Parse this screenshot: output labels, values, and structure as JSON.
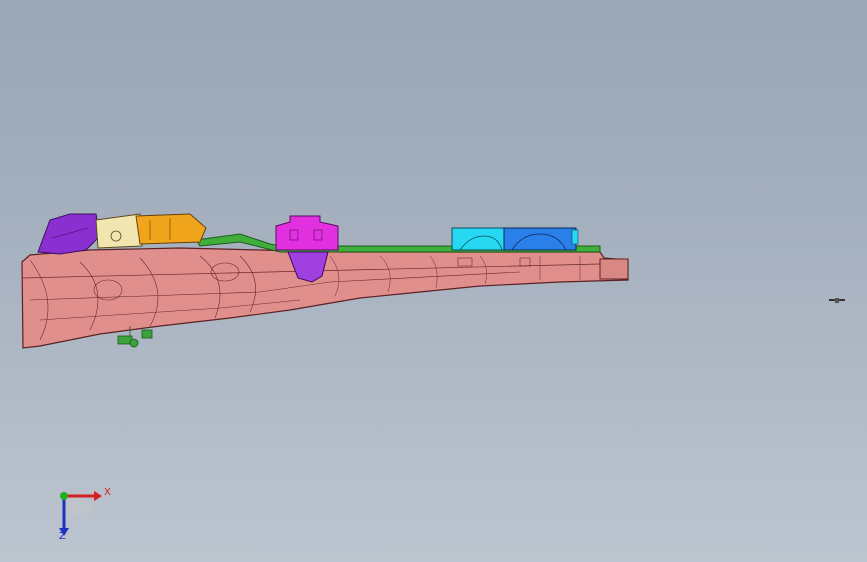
{
  "viewport": {
    "background_top": "#9aa7b7",
    "background_bottom": "#bcc4cf"
  },
  "model": {
    "description_icon": "cad-assembly-model",
    "colors": {
      "frame": "#e08f8c",
      "frame_edge": "#5a2222",
      "purple_part": "#8a2fd0",
      "cream_part": "#f2e6b0",
      "orange_part": "#f0a51c",
      "green_rail": "#3fae3a",
      "magenta_part": "#e030e0",
      "violet_part": "#a040e0",
      "cyan_part": "#27d8f2",
      "blue_part": "#2a7fe8",
      "bracket_green": "#3aa43a"
    }
  },
  "triad": {
    "x_label": "X",
    "z_label": "Z",
    "x_color": "#d42020",
    "y_color": "#20b020",
    "z_color": "#2030c0"
  }
}
